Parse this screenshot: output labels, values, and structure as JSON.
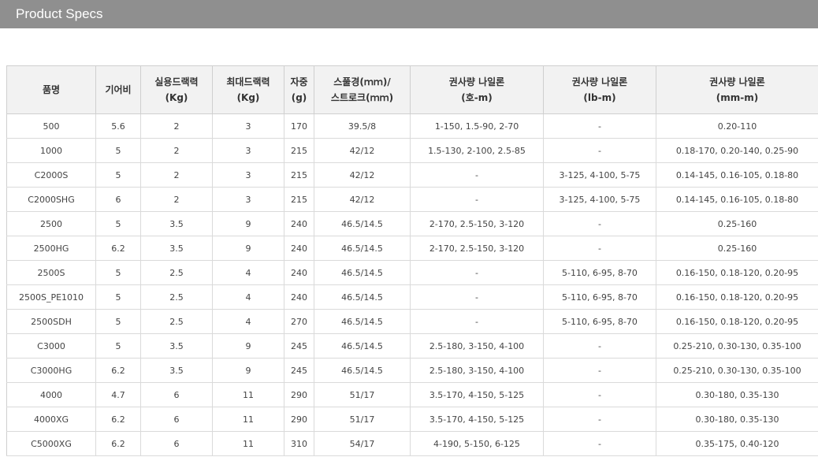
{
  "header": {
    "title": "Product Specs"
  },
  "table": {
    "headers": [
      [
        "품명"
      ],
      [
        "기어비"
      ],
      [
        "실용드랙력",
        "(Kg)"
      ],
      [
        "최대드랙력",
        "(Kg)"
      ],
      [
        "자중",
        "(g)"
      ],
      [
        "스풀경(ｍｍ)/",
        "스트로크(ｍｍ)"
      ],
      [
        "권사량 나일론",
        "(호-m)"
      ],
      [
        "권사량 나일론",
        "(lb-m)"
      ],
      [
        "권사량 나일론",
        "(mm-m)"
      ]
    ],
    "rows": [
      [
        "500",
        "5.6",
        "2",
        "3",
        "170",
        "39.5/8",
        "1-150, 1.5-90, 2-70",
        "-",
        "0.20-110"
      ],
      [
        "1000",
        "5",
        "2",
        "3",
        "215",
        "42/12",
        "1.5-130, 2-100, 2.5-85",
        "-",
        "0.18-170, 0.20-140, 0.25-90"
      ],
      [
        "C2000S",
        "5",
        "2",
        "3",
        "215",
        "42/12",
        "-",
        "3-125, 4-100, 5-75",
        "0.14-145, 0.16-105, 0.18-80"
      ],
      [
        "C2000SHG",
        "6",
        "2",
        "3",
        "215",
        "42/12",
        "-",
        "3-125, 4-100, 5-75",
        "0.14-145, 0.16-105, 0.18-80"
      ],
      [
        "2500",
        "5",
        "3.5",
        "9",
        "240",
        "46.5/14.5",
        "2-170, 2.5-150, 3-120",
        "-",
        "0.25-160"
      ],
      [
        "2500HG",
        "6.2",
        "3.5",
        "9",
        "240",
        "46.5/14.5",
        "2-170, 2.5-150, 3-120",
        "-",
        "0.25-160"
      ],
      [
        "2500S",
        "5",
        "2.5",
        "4",
        "240",
        "46.5/14.5",
        "-",
        "5-110, 6-95, 8-70",
        "0.16-150, 0.18-120, 0.20-95"
      ],
      [
        "2500S_PE1010",
        "5",
        "2.5",
        "4",
        "240",
        "46.5/14.5",
        "-",
        "5-110, 6-95, 8-70",
        "0.16-150, 0.18-120, 0.20-95"
      ],
      [
        "2500SDH",
        "5",
        "2.5",
        "4",
        "270",
        "46.5/14.5",
        "-",
        "5-110, 6-95, 8-70",
        "0.16-150, 0.18-120, 0.20-95"
      ],
      [
        "C3000",
        "5",
        "3.5",
        "9",
        "245",
        "46.5/14.5",
        "2.5-180, 3-150, 4-100",
        "-",
        "0.25-210, 0.30-130, 0.35-100"
      ],
      [
        "C3000HG",
        "6.2",
        "3.5",
        "9",
        "245",
        "46.5/14.5",
        "2.5-180, 3-150, 4-100",
        "-",
        "0.25-210, 0.30-130, 0.35-100"
      ],
      [
        "4000",
        "4.7",
        "6",
        "11",
        "290",
        "51/17",
        "3.5-170, 4-150, 5-125",
        "-",
        "0.30-180, 0.35-130"
      ],
      [
        "4000XG",
        "6.2",
        "6",
        "11",
        "290",
        "51/17",
        "3.5-170, 4-150, 5-125",
        "-",
        "0.30-180, 0.35-130"
      ],
      [
        "C5000XG",
        "6.2",
        "6",
        "11",
        "310",
        "54/17",
        "4-190, 5-150, 6-125",
        "-",
        "0.35-175, 0.40-120"
      ]
    ]
  }
}
